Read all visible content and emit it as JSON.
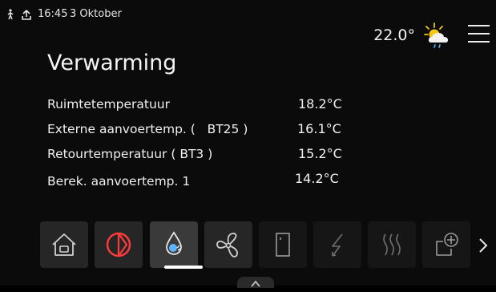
{
  "status_bar": {
    "time": "16:45",
    "date": "3  Oktober",
    "icons": [
      "person-walking-icon",
      "upload-icon"
    ]
  },
  "header": {
    "outdoor_temperature": "22.0°",
    "weather_icon": "sun-cloud-rain-icon",
    "menu_icon": "hamburger-menu-icon"
  },
  "page": {
    "title": "Verwarming"
  },
  "readings": [
    {
      "label": "Ruimtetemperatuur",
      "value": "18.2°C"
    },
    {
      "label": "Externe aanvoertemp. (   BT25 )",
      "value": "16.1°C"
    },
    {
      "label": "Retourtemperatuur ( BT3 )",
      "value": "15.2°C"
    },
    {
      "label": "Berek. aanvoertemp. 1",
      "value": "14.2°C"
    }
  ],
  "toolbar": {
    "items": [
      {
        "icon": "home-icon",
        "state": "normal"
      },
      {
        "icon": "power-cycle-icon",
        "state": "normal",
        "accent": "#ff3b3b"
      },
      {
        "icon": "water-drop-icon",
        "state": "active"
      },
      {
        "icon": "fan-icon",
        "state": "normal"
      },
      {
        "icon": "door-icon",
        "state": "dim"
      },
      {
        "icon": "lightning-icon",
        "state": "dim"
      },
      {
        "icon": "heat-waves-icon",
        "state": "dim"
      },
      {
        "icon": "add-device-icon",
        "state": "dim"
      }
    ],
    "next_icon": "chevron-right-icon"
  },
  "colors": {
    "background": "#0b0b0b",
    "tile": "#262626",
    "accent_red": "#ff3b3b",
    "sun": "#f5c518",
    "drop_blue": "#5ab4ff"
  }
}
